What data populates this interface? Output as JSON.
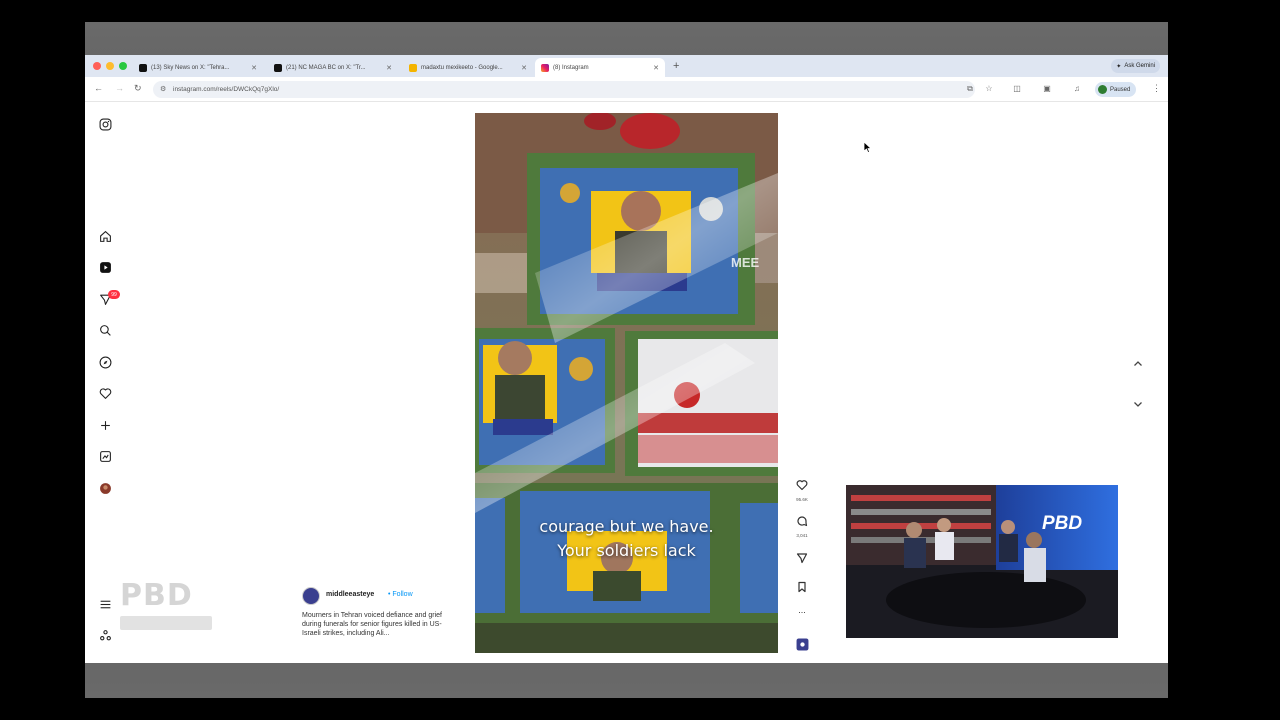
{
  "browser": {
    "tabs": [
      {
        "label": "(13) Sky News on X: \"Tehra...",
        "icon": "x-logo-icon"
      },
      {
        "label": "(21) NC MAGA BC on X: \"Tr...",
        "icon": "x-logo-icon"
      },
      {
        "label": "madaxtu mexikeeto - Google...",
        "icon": "google-docs-icon"
      },
      {
        "label": "(8) Instagram",
        "icon": "instagram-icon"
      }
    ],
    "gemini_label": "Ask Gemini",
    "url": "instagram.com/reels/DWCkQq7gXlo/",
    "profile_status": "Paused"
  },
  "sidebar": {
    "notification_badge": "99"
  },
  "watermark": {
    "text": "PBD"
  },
  "post": {
    "username": "middleeasteye",
    "follow_label": "Follow",
    "separator": "•",
    "caption": "Mourners in Tehran voiced defiance and grief during funerals for senior figures killed in US-Israeli strikes, including Ali..."
  },
  "video": {
    "subtitle_line1": "courage but we have.",
    "subtitle_line2": "Your soldiers lack",
    "watermark": "MEE"
  },
  "actions": {
    "likes": "95.6K",
    "comments": "3,041",
    "more": "..."
  },
  "pip": {
    "logo": "PBD"
  },
  "colors": {
    "instagram_blue": "#0095f6",
    "badge_red": "#ff3040",
    "tab_strip": "#dfe6f2"
  }
}
